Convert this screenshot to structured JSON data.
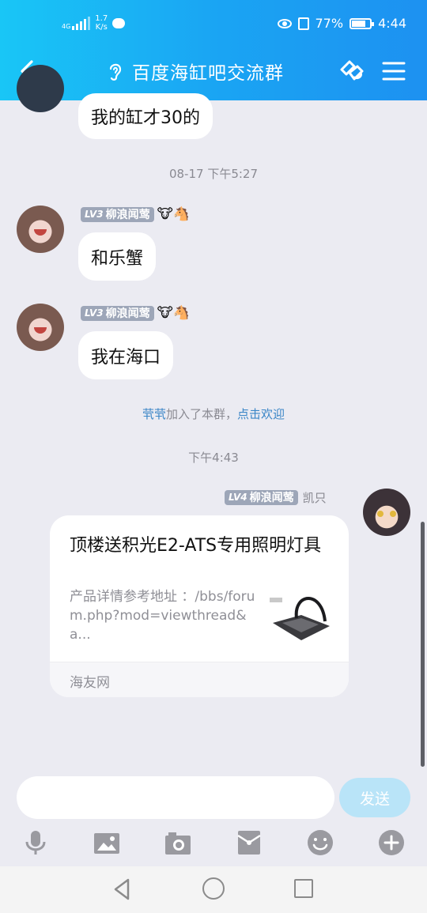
{
  "statusbar": {
    "network": "4G",
    "speed_value": "1.7",
    "speed_unit": "K/s",
    "battery": "77%",
    "time": "4:44"
  },
  "header": {
    "title": "百度海缸吧交流群",
    "back_icon": "chevron-left-icon",
    "ear_icon": "ear-icon",
    "link_icon": "link-icon",
    "menu_icon": "menu-icon"
  },
  "messages": {
    "msg0_text": "我的缸才30的",
    "time1": "08-17 下午5:27",
    "msg1": {
      "level": "LV3",
      "title": "柳浪闻莺",
      "emoji": "🐮🐴",
      "text": "和乐蟹"
    },
    "msg2": {
      "level": "LV3",
      "title": "柳浪闻莺",
      "emoji": "🐮🐴",
      "text": "我在海口"
    },
    "system": {
      "name": "茕茕",
      "text": "加入了本群，",
      "action": "点击欢迎"
    },
    "time2": "下午4:43",
    "msg3": {
      "level": "LV4",
      "title": "柳浪闻莺",
      "nick": "凯只",
      "card": {
        "title": "顶楼送积光E2-ATS专用照明灯具",
        "desc": "产品详情参考地址 ：/bbs/forum.php?mod=viewthread&a...",
        "source": "海友网"
      }
    }
  },
  "input": {
    "placeholder": "",
    "send_label": "发送"
  },
  "toolbar": [
    "mic-icon",
    "image-icon",
    "camera-icon",
    "red-packet-icon",
    "emoji-icon",
    "plus-icon"
  ],
  "colors": {
    "header_start": "#19c6f6",
    "header_end": "#1d91f1",
    "background": "#ebebf2",
    "badge": "#9da6b8",
    "link": "#3b86c7",
    "send_disabled": "#b9e4f8"
  }
}
